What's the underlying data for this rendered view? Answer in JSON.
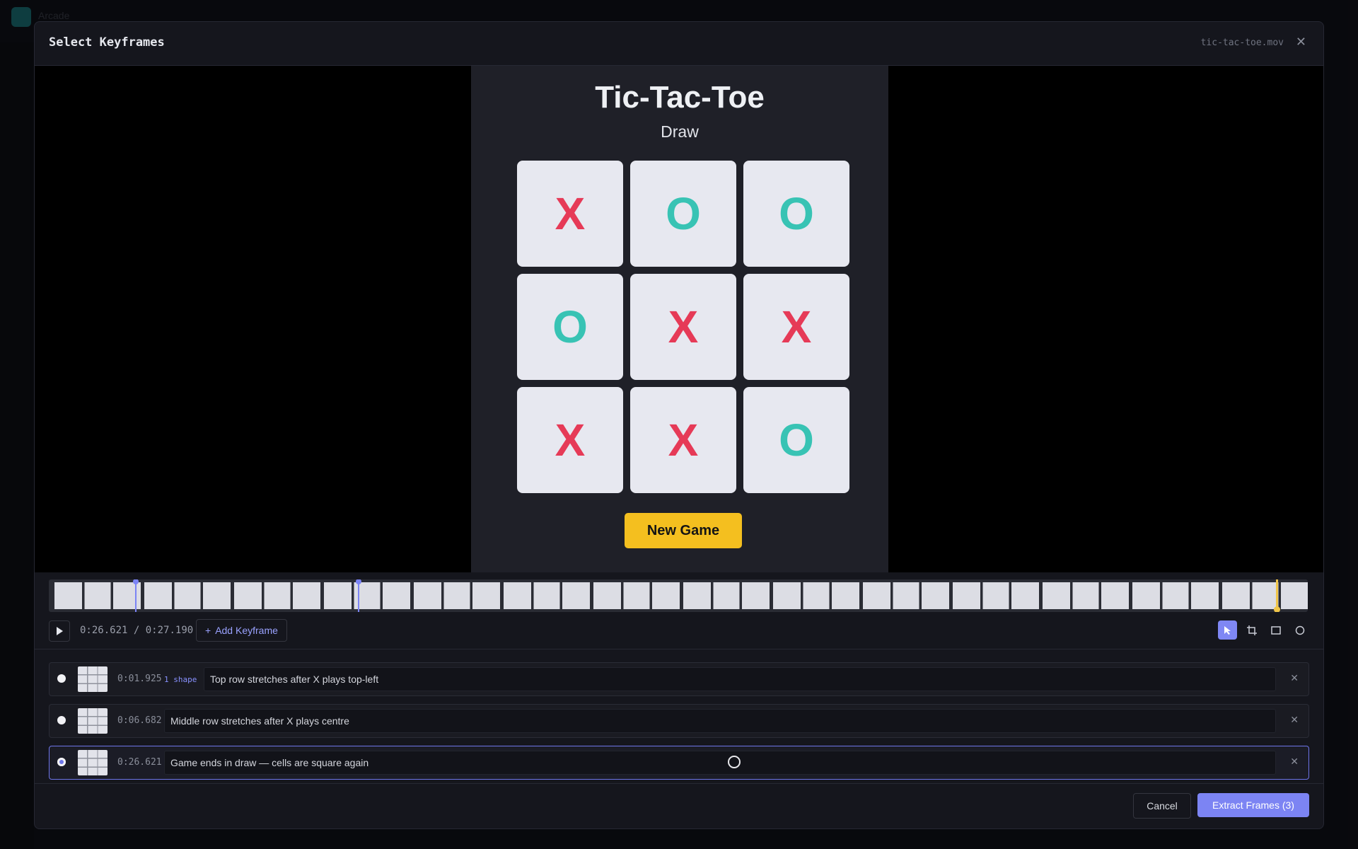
{
  "background": {
    "app_name": "Arcade"
  },
  "modal": {
    "title": "Select Keyframes",
    "file_name": "tic-tac-toe.mov",
    "close_icon": "close-icon"
  },
  "game": {
    "title": "Tic-Tac-Toe",
    "status": "Draw",
    "cells": [
      "X",
      "O",
      "O",
      "O",
      "X",
      "X",
      "X",
      "X",
      "O"
    ],
    "new_game_label": "New Game",
    "colors": {
      "x": "#e63a57",
      "o": "#38c3b4",
      "button": "#f4bf1f"
    }
  },
  "timeline": {
    "current_time": "0:26.621",
    "separator": "/",
    "total_time": "0:27.190",
    "add_keyframe_label": "Add Keyframe",
    "play_icon": "play-icon",
    "tools": [
      "pointer-icon",
      "crop-icon",
      "rectangle-icon",
      "circle-icon"
    ],
    "playhead_progress": 0.979
  },
  "keyframes": [
    {
      "time": "0:01.925",
      "shape_label": "1 shape",
      "description": "Top row stretches after X plays top-left",
      "selected": false
    },
    {
      "time": "0:06.682",
      "shape_label": "",
      "description": "Middle row stretches after X plays centre",
      "selected": false
    },
    {
      "time": "0:26.621",
      "shape_label": "",
      "description": "Game ends in draw — cells are square again",
      "selected": true
    }
  ],
  "footer": {
    "cancel_label": "Cancel",
    "extract_label": "Extract Frames (3)",
    "accent": "#7c84f3"
  }
}
